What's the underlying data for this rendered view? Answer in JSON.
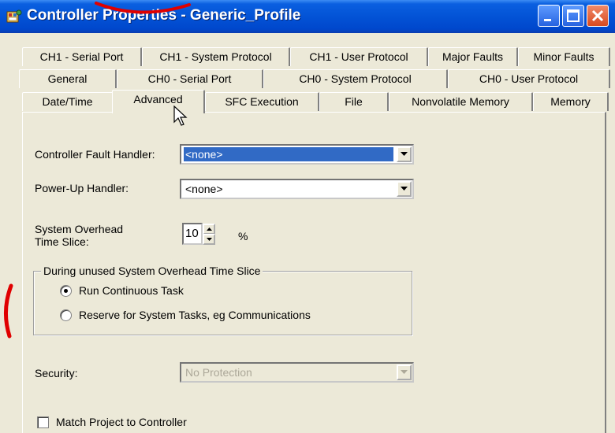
{
  "window": {
    "title": "Controller Properties - Generic_Profile"
  },
  "tabs": {
    "row1": [
      "CH1 -  Serial Port",
      "CH1 - System Protocol",
      "CH1 - User Protocol",
      "Major Faults",
      "Minor Faults"
    ],
    "row2": [
      "General",
      "CH0 -  Serial Port",
      "CH0 - System Protocol",
      "CH0 - User Protocol"
    ],
    "row3": [
      "Date/Time",
      "Advanced",
      "SFC Execution",
      "File",
      "Nonvolatile Memory",
      "Memory"
    ],
    "active": "Advanced"
  },
  "form": {
    "fault_handler_label": "Controller Fault Handler:",
    "fault_handler_value": "<none>",
    "powerup_handler_label": "Power-Up Handler:",
    "powerup_handler_value": "<none>",
    "overhead_label_line1": "System Overhead",
    "overhead_label_line2": "Time Slice:",
    "overhead_value": "10",
    "overhead_unit": "%",
    "group_title": "During unused System Overhead Time Slice",
    "radio_continuous": "Run Continuous Task",
    "radio_continuous_checked": true,
    "radio_reserve": "Reserve for System Tasks, eg Communications",
    "radio_reserve_checked": false,
    "security_label": "Security:",
    "security_value": "No Protection",
    "match_project_label": "Match Project to Controller",
    "match_project_checked": false
  },
  "colors": {
    "titlebar": "#0353d6",
    "selection": "#316ac5",
    "dialog_bg": "#ece9d8",
    "annotation": "#e00000"
  }
}
